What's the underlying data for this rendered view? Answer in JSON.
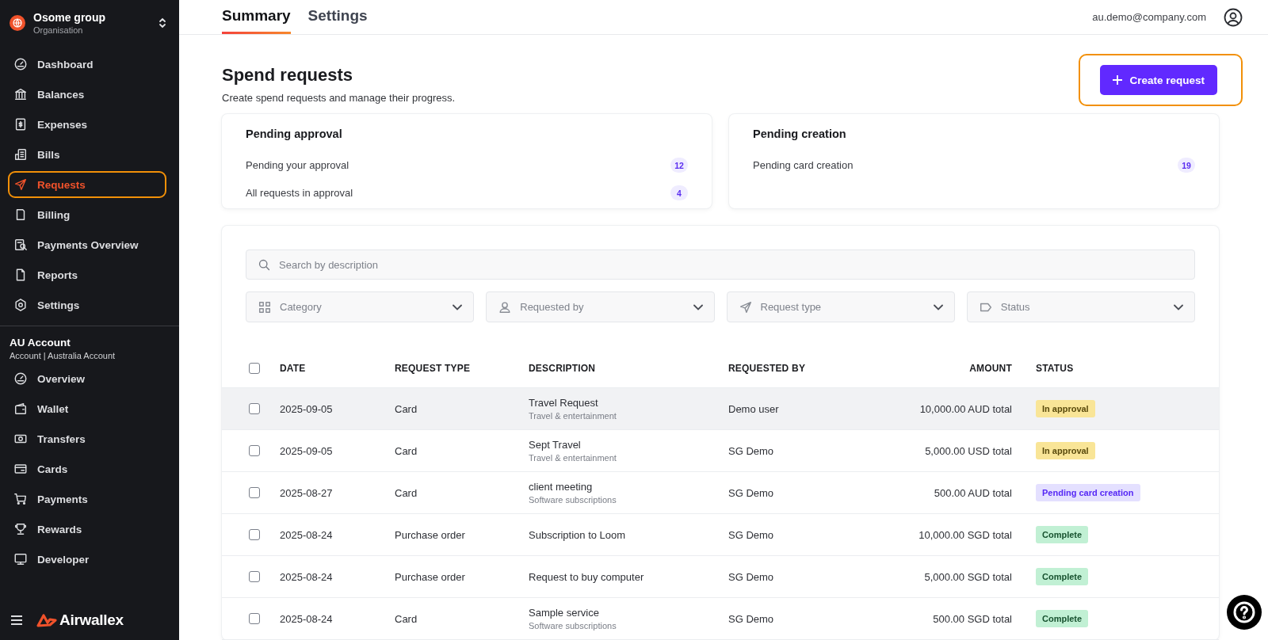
{
  "sidebar": {
    "org": {
      "name": "Osome group",
      "subtitle": "Organisation"
    },
    "items": [
      {
        "label": "Dashboard",
        "selected": false,
        "annotated": false
      },
      {
        "label": "Balances",
        "selected": false,
        "annotated": false
      },
      {
        "label": "Expenses",
        "selected": false,
        "annotated": false
      },
      {
        "label": "Bills",
        "selected": false,
        "annotated": false
      },
      {
        "label": "Requests",
        "selected": true,
        "annotated": true
      },
      {
        "label": "Billing",
        "selected": false,
        "annotated": false
      },
      {
        "label": "Payments Overview",
        "selected": false,
        "annotated": false
      },
      {
        "label": "Reports",
        "selected": false,
        "annotated": false
      },
      {
        "label": "Settings",
        "selected": false,
        "annotated": false
      }
    ],
    "account": {
      "name": "AU Account",
      "subtitle": "Account | Australia Account"
    },
    "account_items": [
      {
        "label": "Overview",
        "selected": false
      },
      {
        "label": "Wallet",
        "selected": false
      },
      {
        "label": "Transfers",
        "selected": false
      },
      {
        "label": "Cards",
        "selected": false
      },
      {
        "label": "Payments",
        "selected": false
      },
      {
        "label": "Rewards",
        "selected": false
      },
      {
        "label": "Developer",
        "selected": false
      }
    ],
    "brand": "Airwallex"
  },
  "tabs": [
    {
      "label": "Summary",
      "selected": true
    },
    {
      "label": "Settings",
      "selected": false
    }
  ],
  "user_email": "au.demo@company.com",
  "page": {
    "title": "Spend requests",
    "subtitle": "Create spend requests and manage their progress.",
    "create_button": {
      "label": "Create request",
      "annotated": true
    }
  },
  "summary_cards": [
    {
      "title": "Pending approval",
      "rows": [
        {
          "label": "Pending your approval",
          "count": "12"
        },
        {
          "label": "All requests in approval",
          "count": "4"
        }
      ]
    },
    {
      "title": "Pending creation",
      "rows": [
        {
          "label": "Pending card creation",
          "count": "19"
        }
      ]
    }
  ],
  "search": {
    "placeholder": "Search by description"
  },
  "filters": [
    {
      "placeholder": "Category"
    },
    {
      "placeholder": "Requested by"
    },
    {
      "placeholder": "Request type"
    },
    {
      "placeholder": "Status"
    }
  ],
  "table": {
    "select_all": {
      "checked": false
    },
    "columns": [
      "DATE",
      "REQUEST TYPE",
      "DESCRIPTION",
      "REQUESTED BY",
      "AMOUNT",
      "STATUS"
    ],
    "rows": [
      {
        "checked": false,
        "highlighted": true,
        "date": "2025-09-05",
        "type": "Card",
        "description": "Travel Request",
        "category": "Travel & entertainment",
        "requested_by": "Demo user",
        "amount": "10,000.00 AUD total",
        "status": {
          "label": "In approval",
          "kind": "approval"
        }
      },
      {
        "checked": false,
        "highlighted": false,
        "date": "2025-09-05",
        "type": "Card",
        "description": "Sept Travel",
        "category": "Travel & entertainment",
        "requested_by": "SG Demo",
        "amount": "5,000.00 USD total",
        "status": {
          "label": "In approval",
          "kind": "approval"
        }
      },
      {
        "checked": false,
        "highlighted": false,
        "date": "2025-08-27",
        "type": "Card",
        "description": "client meeting",
        "category": "Software subscriptions",
        "requested_by": "SG Demo",
        "amount": "500.00 AUD total",
        "status": {
          "label": "Pending card creation",
          "kind": "pending"
        }
      },
      {
        "checked": false,
        "highlighted": false,
        "date": "2025-08-24",
        "type": "Purchase order",
        "description": "Subscription to Loom",
        "requested_by": "SG Demo",
        "amount": "10,000.00 SGD total",
        "status": {
          "label": "Complete",
          "kind": "complete"
        }
      },
      {
        "checked": false,
        "highlighted": false,
        "date": "2025-08-24",
        "type": "Purchase order",
        "description": "Request to buy computer",
        "requested_by": "SG Demo",
        "amount": "5,000.00 SGD total",
        "status": {
          "label": "Complete",
          "kind": "complete"
        }
      },
      {
        "checked": false,
        "highlighted": false,
        "date": "2025-08-24",
        "type": "Card",
        "description": "Sample service",
        "category": "Software subscriptions",
        "requested_by": "SG Demo",
        "amount": "500.00 SGD total",
        "status": {
          "label": "Complete",
          "kind": "complete"
        }
      }
    ]
  }
}
